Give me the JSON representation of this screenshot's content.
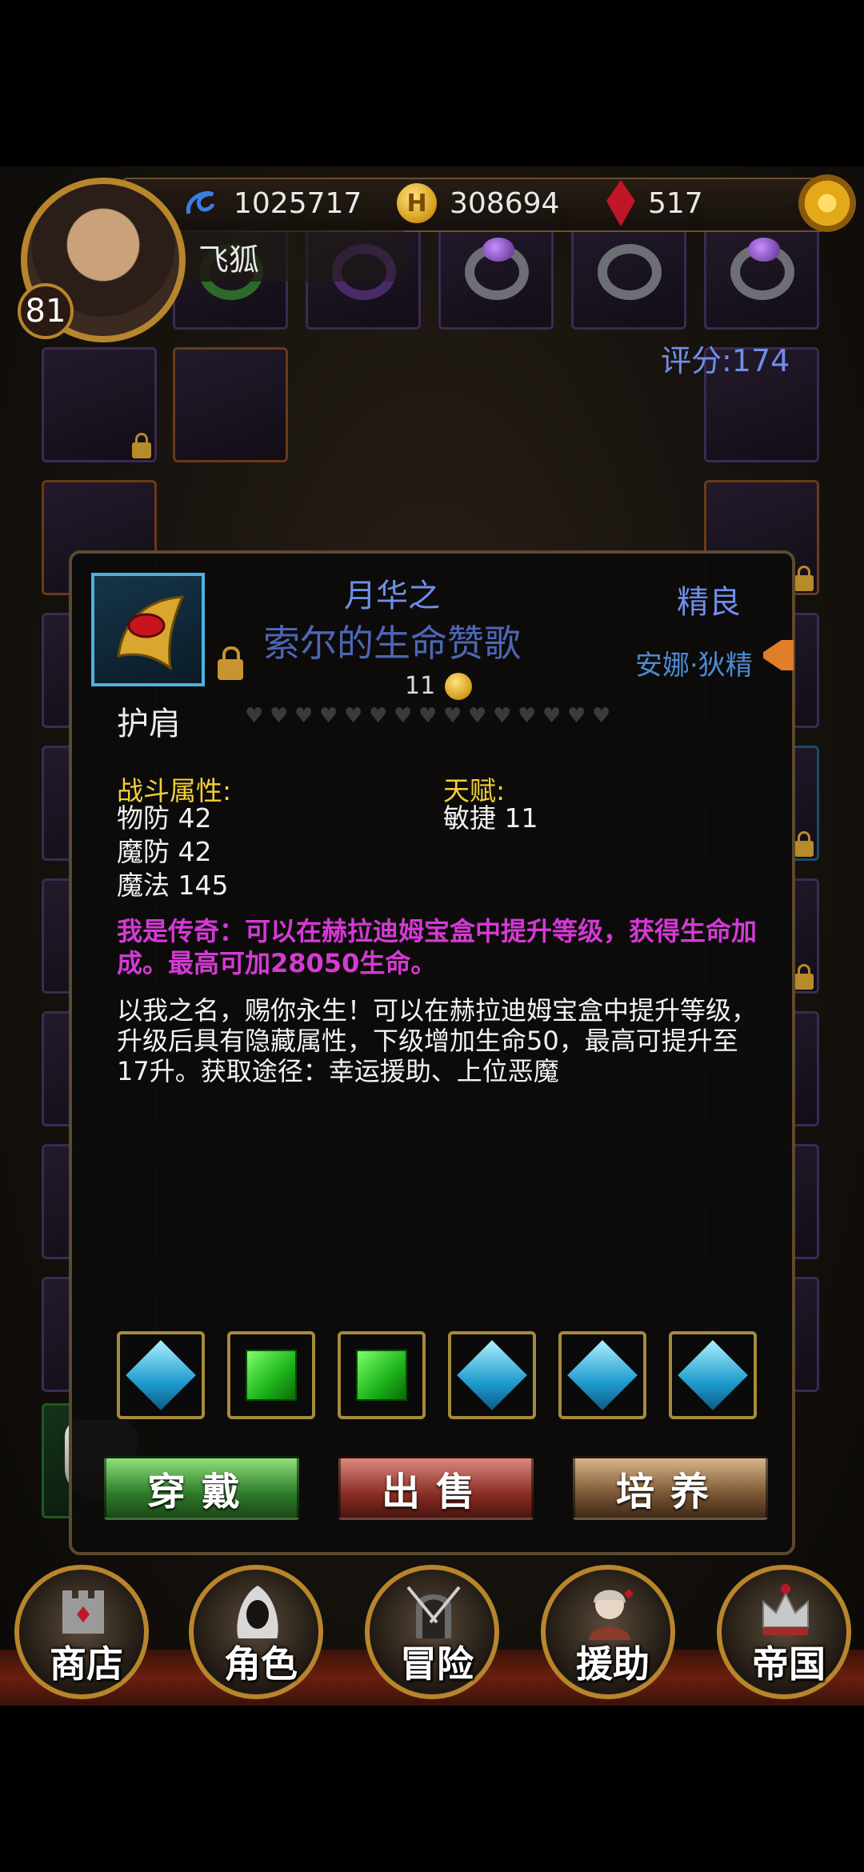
{
  "hud": {
    "player_name": "飞狐",
    "level": "81",
    "xp": "1025717",
    "gold": "308694",
    "gems": "517",
    "score": "评分:174"
  },
  "item": {
    "name_line1": "月华之",
    "name_line2": "索尔的生命赞歌",
    "quality": "精良",
    "owner": "安娜·狄精",
    "price": "11",
    "slot": "护肩",
    "stars_total": 15,
    "combat_label": "战斗属性:",
    "combat_stats": [
      "物防 42",
      "魔防 42",
      "魔法 145"
    ],
    "talent_label": "天赋:",
    "talent_stats": [
      "敏捷 11"
    ],
    "legend_text": "我是传奇：可以在赫拉迪姆宝盒中提升等级，获得生命加成。最高可加28050生命。",
    "description": "以我之名，赐你永生！可以在赫拉迪姆宝盒中提升等级，升级后具有隐藏属性，下级增加生命50，最高可提升至17升。获取途径：幸运援助、上位恶魔",
    "gem_slots": [
      "blue",
      "green",
      "green",
      "blue",
      "blue",
      "blue"
    ]
  },
  "buttons": {
    "wear": "穿戴",
    "sell": "出售",
    "train": "培养"
  },
  "nav": [
    {
      "label": "商店",
      "icon": "castle-icon"
    },
    {
      "label": "角色",
      "icon": "hooded-figure-icon"
    },
    {
      "label": "冒险",
      "icon": "gate-swords-icon"
    },
    {
      "label": "援助",
      "icon": "helper-portrait-icon"
    },
    {
      "label": "帝国",
      "icon": "crown-icon"
    }
  ],
  "colors": {
    "rare_blue": "#6f8ee8",
    "legend_magenta": "#d43ad4",
    "section_gold": "#f2cf3a"
  }
}
